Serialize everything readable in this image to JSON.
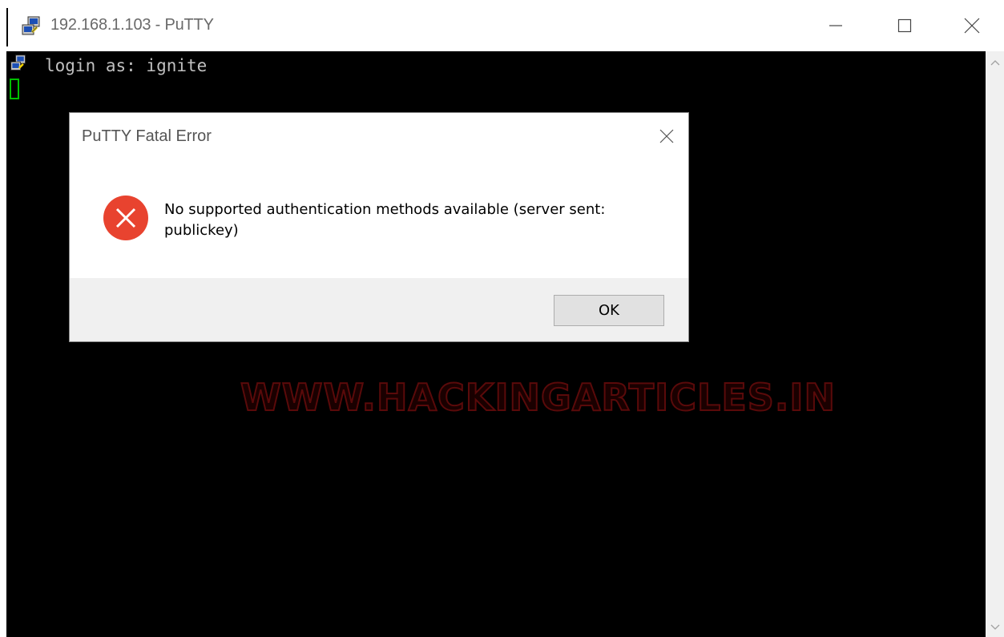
{
  "window": {
    "title": "192.168.1.103 - PuTTY",
    "controls": {
      "minimize": "minimize-icon",
      "maximize": "maximize-icon",
      "close": "close-icon"
    }
  },
  "terminal": {
    "lines": [
      "login as: ignite"
    ],
    "cursor_color": "#00c000",
    "background": "#000000",
    "text_color": "#c0c0c0"
  },
  "watermark": {
    "text": "WWW.HACKINGARTICLES.IN",
    "color": "#5a0a0a"
  },
  "dialog": {
    "title": "PuTTY Fatal Error",
    "icon": "error-icon",
    "message": "No supported authentication methods available (server sent: publickey)",
    "ok_label": "OK",
    "error_color": "#e8432f"
  }
}
